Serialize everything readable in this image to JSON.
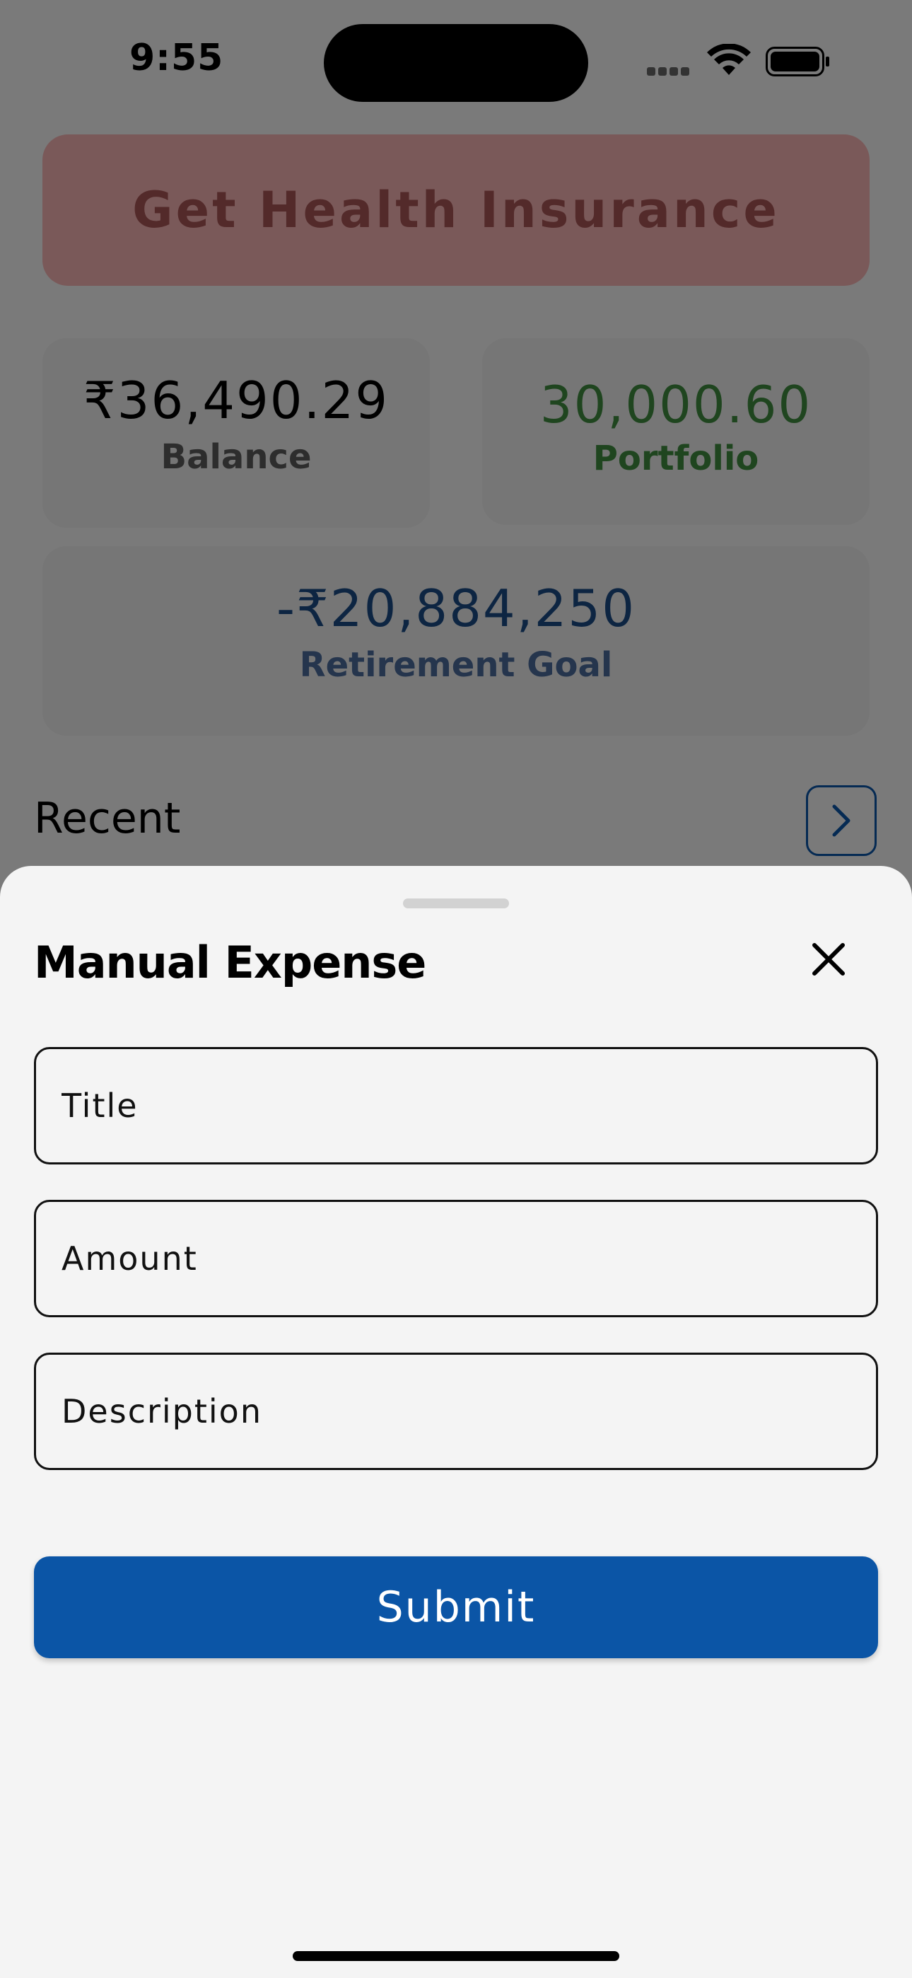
{
  "status_bar": {
    "time": "9:55"
  },
  "background": {
    "insurance_button": "Get Health Insurance",
    "cards": {
      "balance": {
        "value": "₹36,490.29",
        "label": "Balance"
      },
      "portfolio": {
        "value": "30,000.60",
        "label": "Portfolio"
      },
      "retirement": {
        "value": "-₹20,884,250",
        "label": "Retirement Goal"
      }
    },
    "recent_title": "Recent"
  },
  "sheet": {
    "title": "Manual Expense",
    "fields": {
      "title_placeholder": "Title",
      "amount_placeholder": "Amount",
      "description_placeholder": "Description"
    },
    "submit_label": "Submit"
  },
  "colors": {
    "accent": "#0b55a6",
    "insurance_bg": "#f5b3b3",
    "portfolio_green": "#3f8a3f",
    "retirement_blue": "#1b4a85"
  },
  "icons": [
    "wifi-icon",
    "battery-icon",
    "signal-icon",
    "chevron-right-icon",
    "close-icon"
  ]
}
